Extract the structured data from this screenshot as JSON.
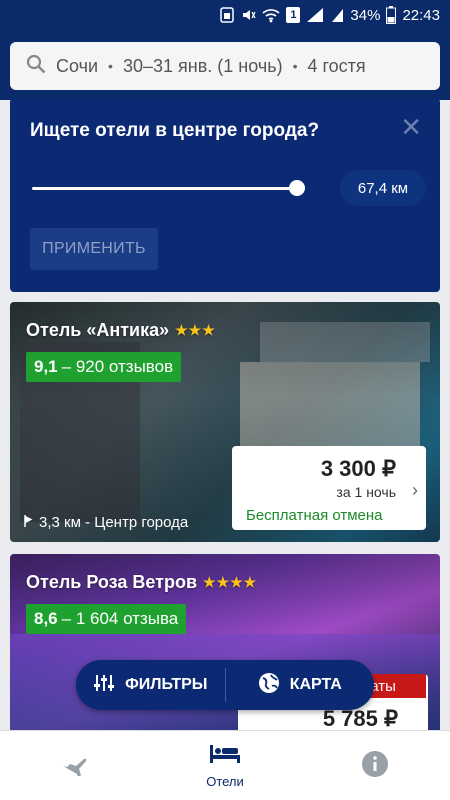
{
  "status": {
    "battery": "34%",
    "time": "22:43",
    "sim": "1",
    "icons": [
      "sim-icon",
      "mute-icon",
      "wifi-icon",
      "signal-icon",
      "battery-icon"
    ]
  },
  "search": {
    "city": "Сочи",
    "dates": "30–31 янв. (1 ночь)",
    "guests": "4 гостя",
    "icon": "search-icon"
  },
  "promo": {
    "title": "Ищете отели в центре города?",
    "distance_value": "67,4 км",
    "distance_fraction": 1.0,
    "apply_label": "ПРИМЕНИТЬ"
  },
  "hotels": [
    {
      "name": "Отель «Антика»",
      "stars": "★★★",
      "star_count": 3,
      "rating": "9,1",
      "reviews": "– 920 отзывов",
      "price": "3 300 ₽",
      "price_note": "за 1 ночь",
      "free_cancel": "Бесплатная отмена",
      "distance": "3,3 км - Центр города"
    },
    {
      "name": "Отель Роза Ветров",
      "stars": "★★★★",
      "star_count": 4,
      "rating": "8,6",
      "reviews": "– 1 604 отзыва",
      "tag_partial": "наты",
      "price": "5 785 ₽"
    }
  ],
  "fab": {
    "filters": "ФИЛЬТРЫ",
    "map": "КАРТА"
  },
  "nav": {
    "flights_icon": "airplane-icon",
    "hotels_label": "Отели",
    "info_icon": "info-icon"
  },
  "colors": {
    "brand": "#0b2a6a",
    "rating_green": "#1fa12f",
    "cancel_green": "#1c8a2a",
    "star": "#f7c31a"
  }
}
